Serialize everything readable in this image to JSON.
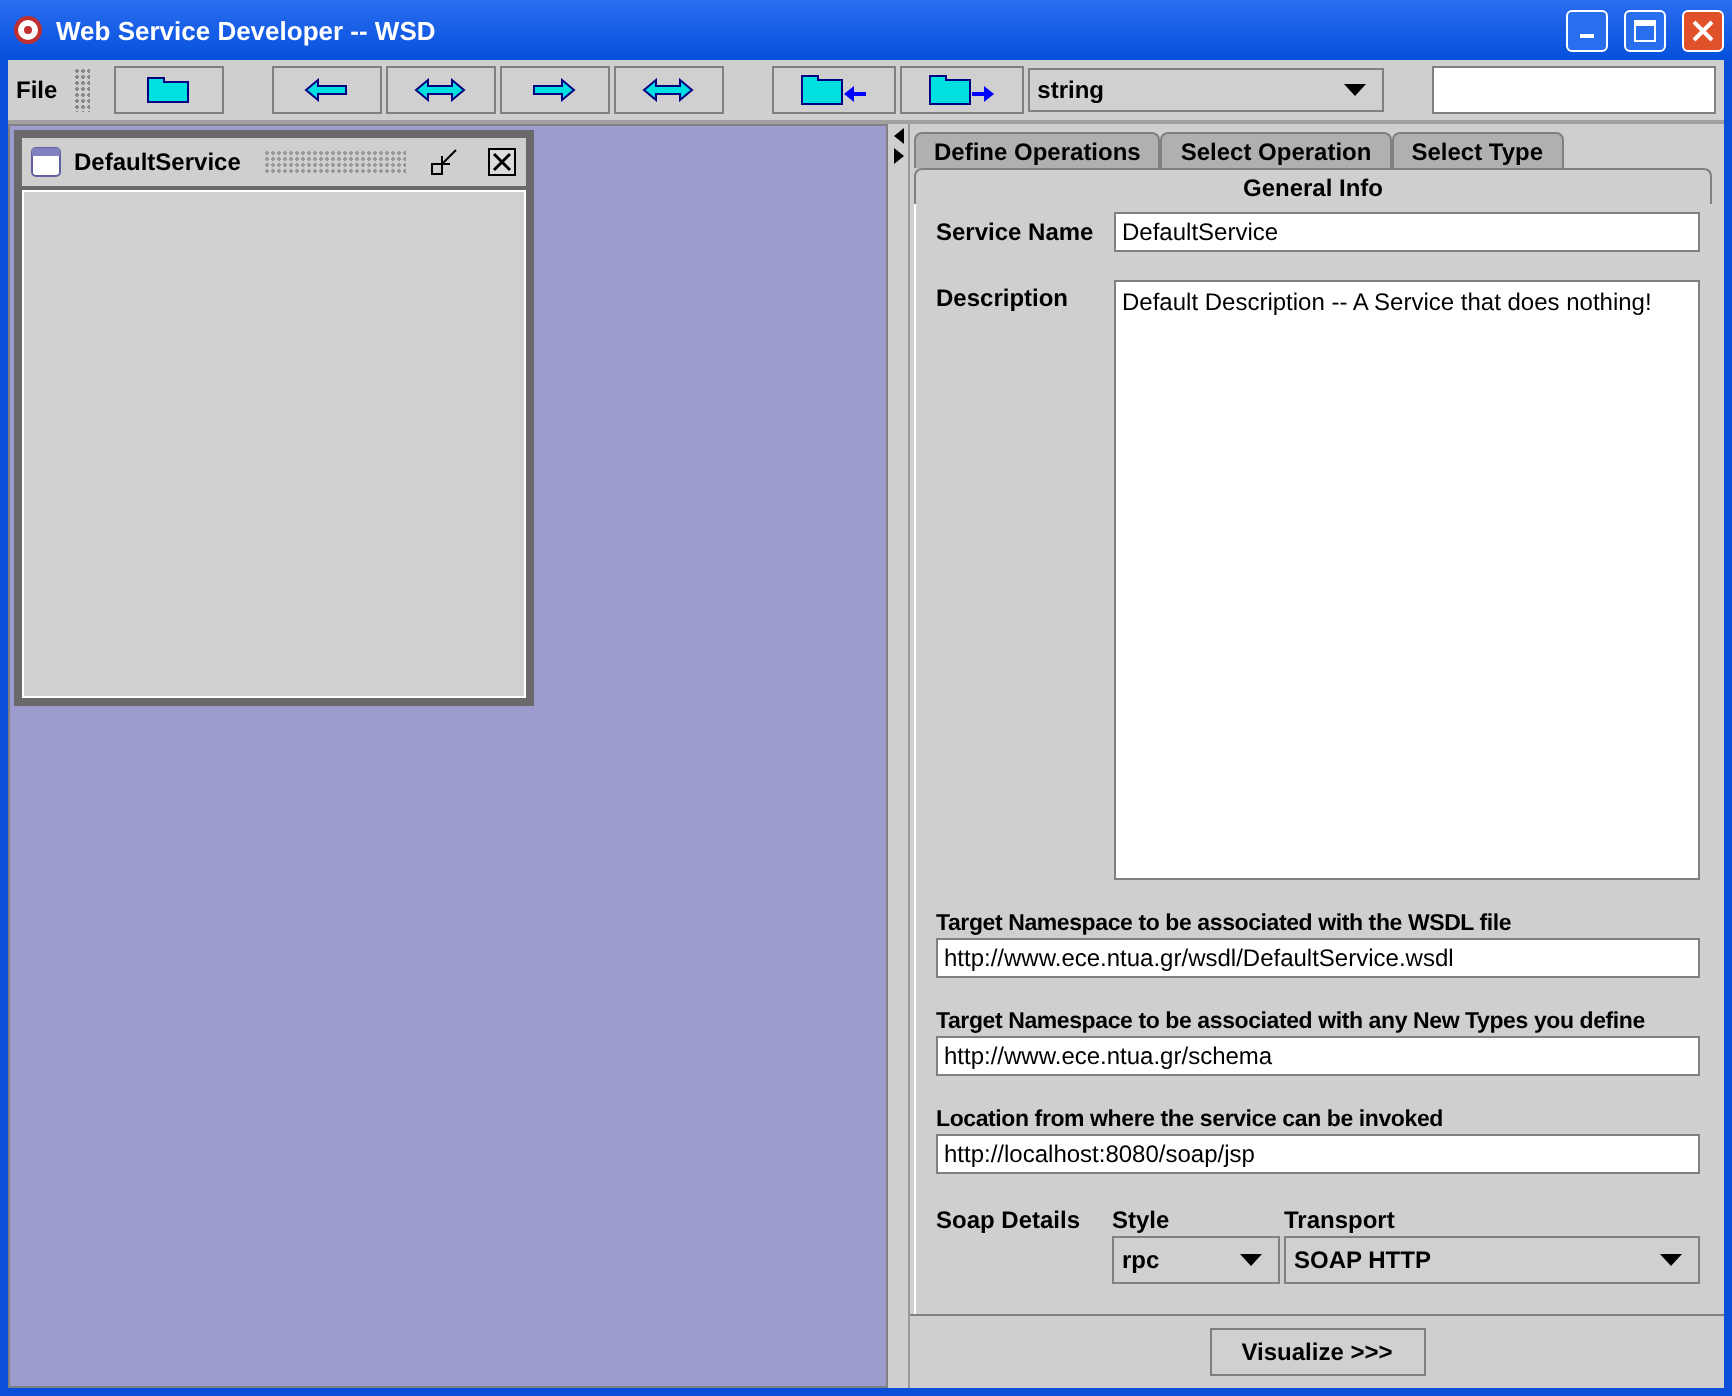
{
  "window": {
    "title": "Web Service Developer -- WSD"
  },
  "toolbar": {
    "menu": "File",
    "buttons": [
      {
        "kind": "folder"
      },
      {
        "kind": "left"
      },
      {
        "kind": "both"
      },
      {
        "kind": "right"
      },
      {
        "kind": "both"
      },
      {
        "kind": "folder-in"
      },
      {
        "kind": "folder-out"
      }
    ],
    "type_combo": "string"
  },
  "internal_frame": {
    "title": "DefaultService"
  },
  "tabs": [
    {
      "label": "Define Operations",
      "selected": false
    },
    {
      "label": "Select Operation",
      "selected": false
    },
    {
      "label": "Select Type",
      "selected": false
    },
    {
      "label": "General Info",
      "selected": true
    }
  ],
  "form": {
    "service_name_label": "Service Name",
    "service_name": "DefaultService",
    "description_label": "Description",
    "description": "Default Description -- A Service that does nothing!",
    "fields": [
      {
        "label": "Target Namespace to be associated with the WSDL file",
        "value": "http://www.ece.ntua.gr/wsdl/DefaultService.wsdl"
      },
      {
        "label": "Target Namespace to be associated with any New Types you define",
        "value": "http://www.ece.ntua.gr/schema"
      },
      {
        "label": "Location from where the service can be invoked",
        "value": "http://localhost:8080/soap/jsp"
      }
    ],
    "soap_label": "Soap Details",
    "style_label": "Style",
    "style": "rpc",
    "transport_label": "Transport",
    "transport": "SOAP HTTP"
  },
  "visualize_button": "Visualize >>>"
}
